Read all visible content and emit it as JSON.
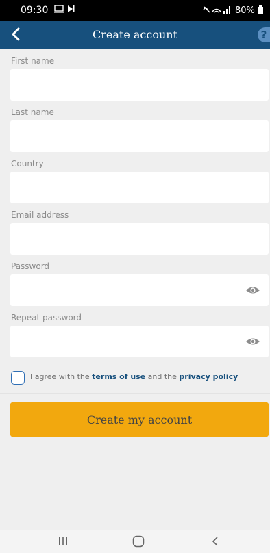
{
  "status_bar": {
    "time": "09:30",
    "battery_text": "80%"
  },
  "app_bar": {
    "title": "Create account",
    "help_label": "?"
  },
  "form": {
    "first_name_label": "First name",
    "last_name_label": "Last name",
    "country_label": "Country",
    "email_label": "Email address",
    "password_label": "Password",
    "repeat_password_label": "Repeat password",
    "agree_prefix": "I agree with the",
    "terms_link": "terms of use",
    "agree_middle": "and the",
    "privacy_link": "privacy policy",
    "submit_label": "Create my account"
  },
  "colors": {
    "app_bar": "#17507d",
    "submit_button": "#f2a80e",
    "background": "#efefef"
  },
  "icons": [
    "back-icon",
    "help-icon",
    "eye-icon",
    "recents-icon",
    "home-icon",
    "nav-back-icon"
  ]
}
